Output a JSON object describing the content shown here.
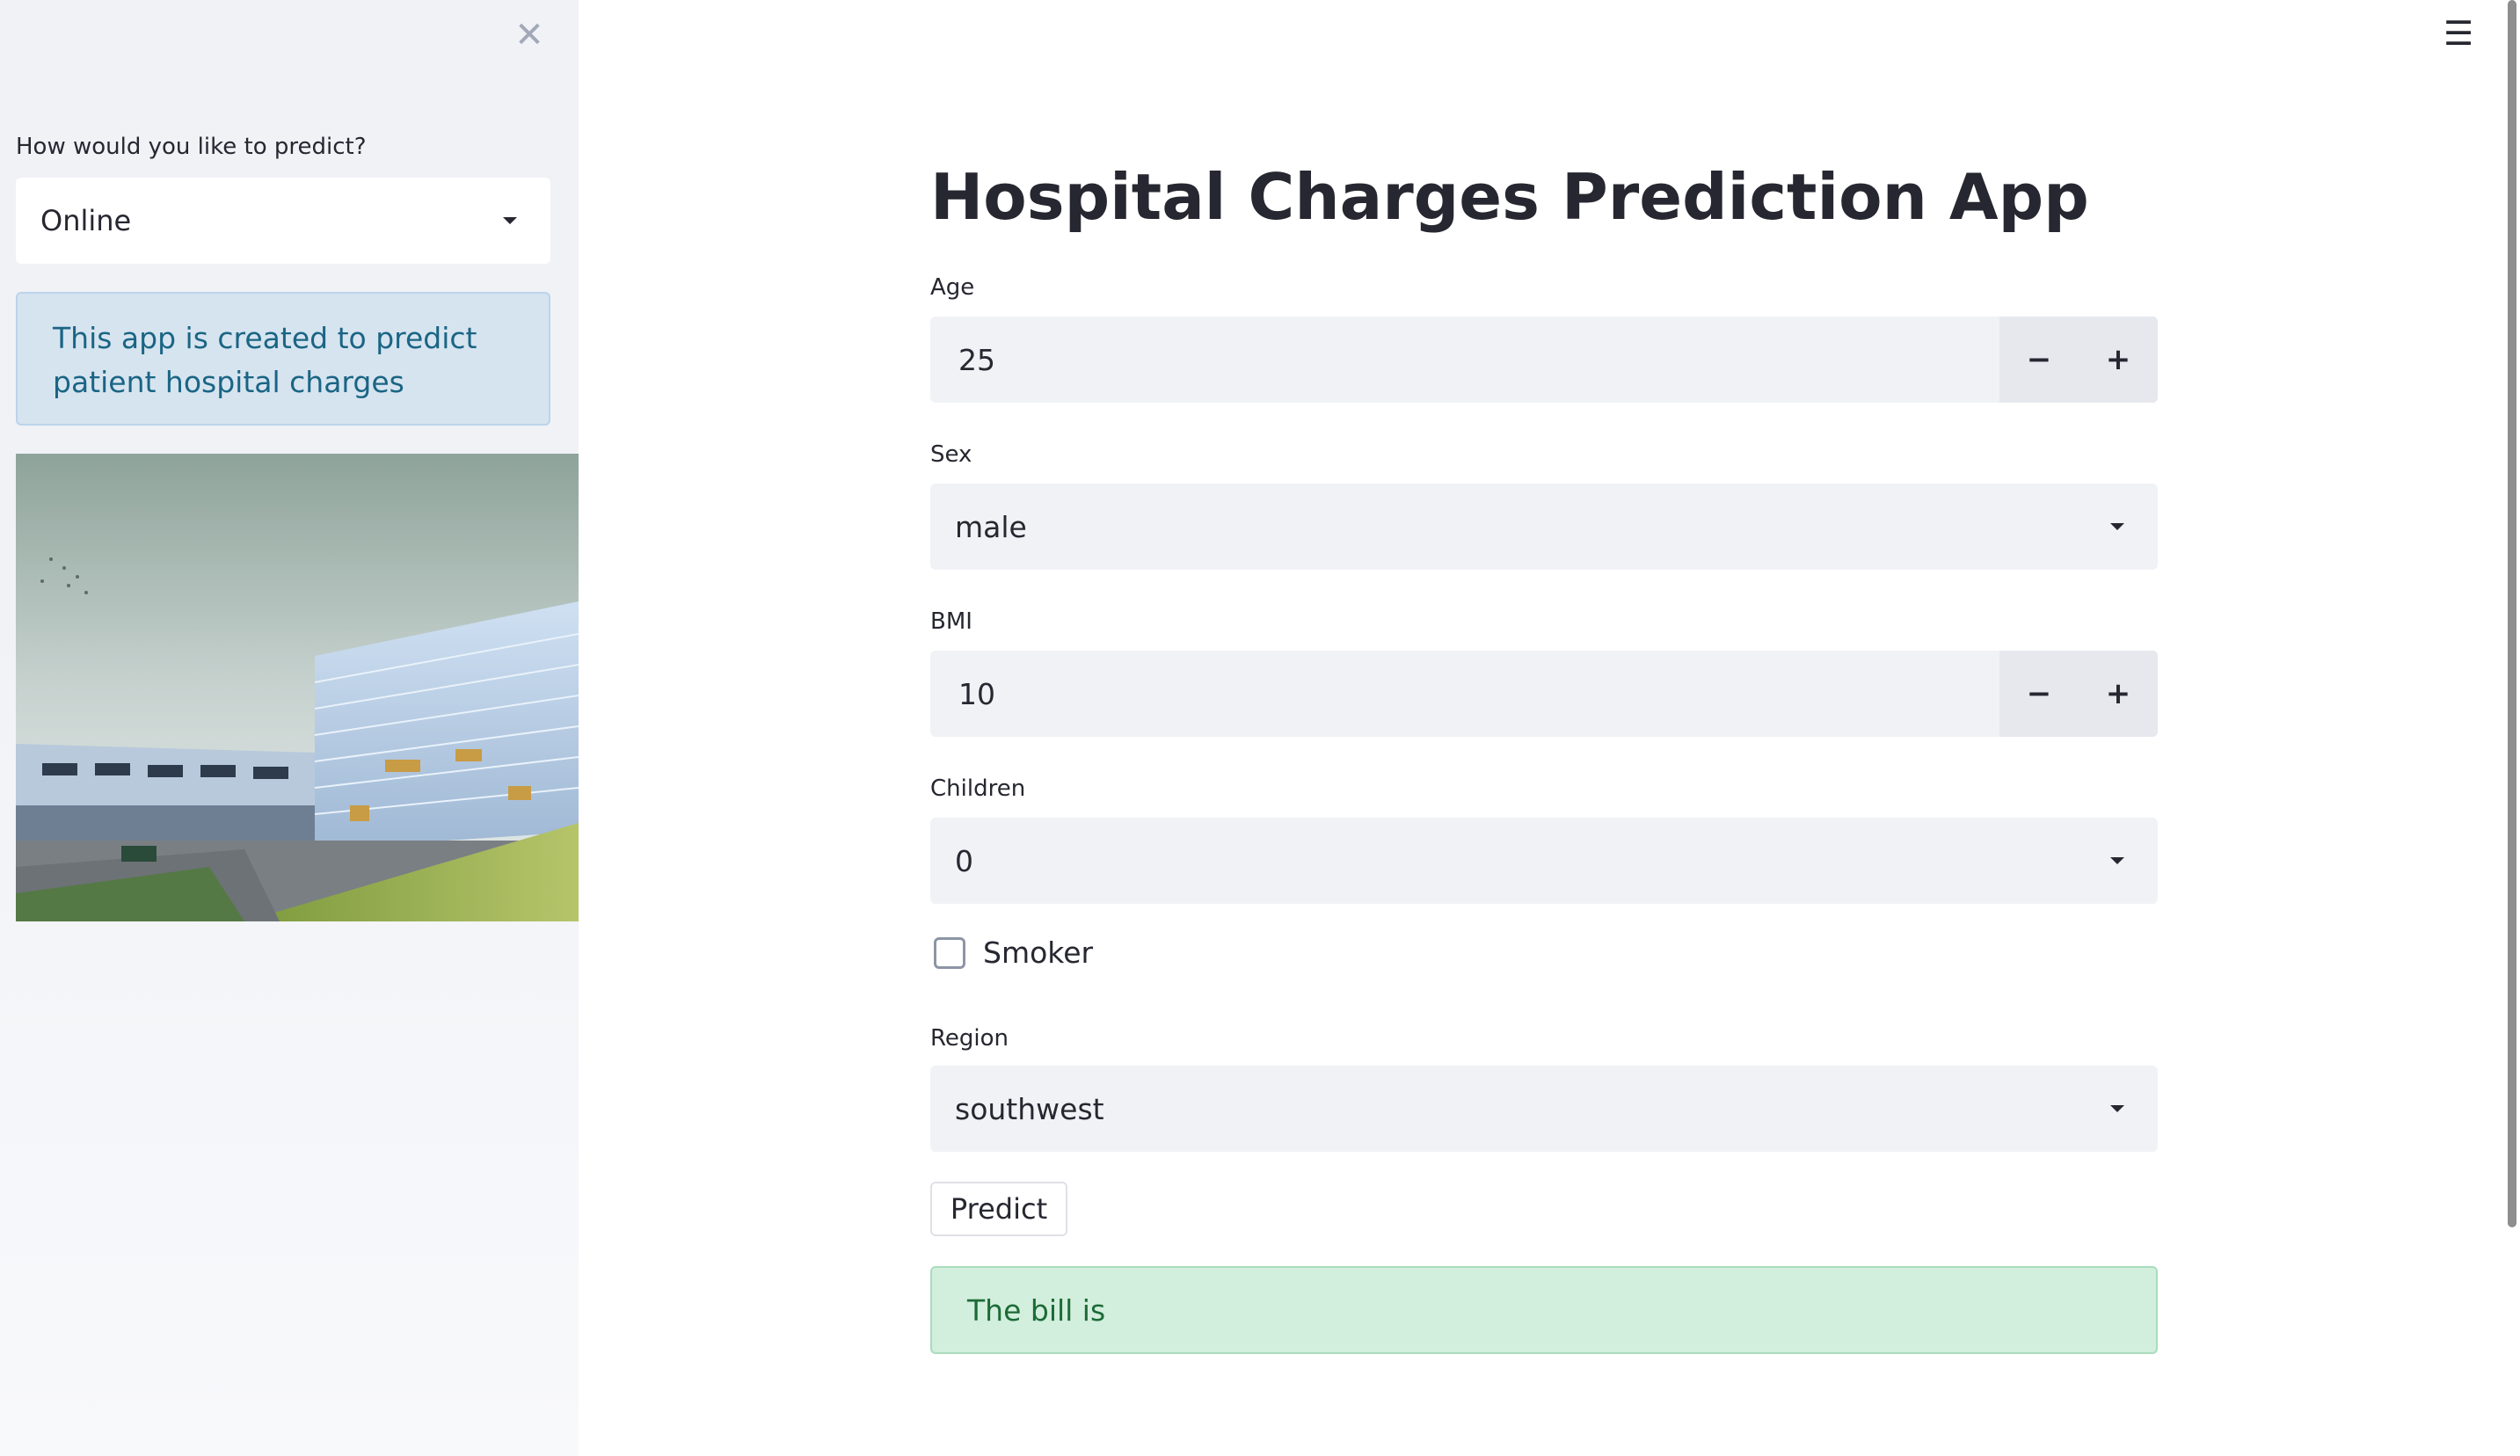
{
  "sidebar": {
    "prediction_label": "How would you like to predict?",
    "prediction_mode": "Online",
    "info_text": "This app is created to predict patient hospital charges",
    "close_icon": "close-icon"
  },
  "header": {
    "menu_icon": "hamburger-menu-icon"
  },
  "main": {
    "title": "Hospital Charges Prediction App",
    "age": {
      "label": "Age",
      "value": "25",
      "decrement": "−",
      "increment": "+"
    },
    "sex": {
      "label": "Sex",
      "value": "male"
    },
    "bmi": {
      "label": "BMI",
      "value": "10",
      "decrement": "−",
      "increment": "+"
    },
    "children": {
      "label": "Children",
      "value": "0"
    },
    "smoker": {
      "label": "Smoker",
      "checked": false
    },
    "region": {
      "label": "Region",
      "value": "southwest"
    },
    "predict_button": "Predict",
    "result_text": "The bill is"
  },
  "colors": {
    "sidebar_bg": "#f0f2f6",
    "info_bg": "#d6e4f0",
    "info_text": "#1a6584",
    "success_bg": "#d2eedc",
    "success_text": "#1c6b37",
    "input_bg": "#f0f2f6"
  }
}
